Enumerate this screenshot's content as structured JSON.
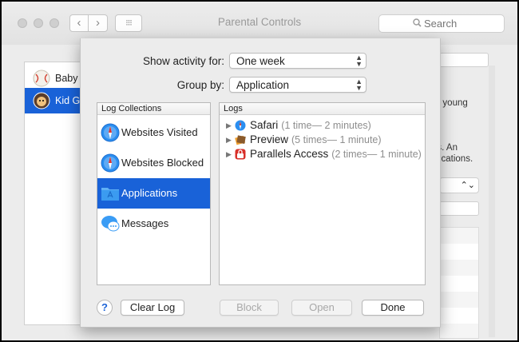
{
  "window": {
    "title": "Parental Controls",
    "nav_back": "‹",
    "nav_forward": "›",
    "grid_glyph": "⁝⁝⁝",
    "search_placeholder": "Search",
    "search_icon": "search-icon"
  },
  "background": {
    "users": [
      {
        "name": "Baby G",
        "icon": "baseball-avatar-icon"
      },
      {
        "name": "Kid Ge",
        "icon": "kid-avatar-icon",
        "selected": true
      }
    ],
    "right_text_1": "or young",
    "right_text_2a": "ns. An",
    "right_text_2b": "plications.",
    "select_arrows": "⌃⌄"
  },
  "sheet": {
    "show_activity_label": "Show activity for:",
    "show_activity_value": "One week",
    "group_by_label": "Group by:",
    "group_by_value": "Application",
    "collections_header": "Log Collections",
    "logs_header": "Logs",
    "collections": [
      {
        "label": "Websites Visited",
        "icon": "safari-compass-icon",
        "selected": false
      },
      {
        "label": "Websites Blocked",
        "icon": "safari-compass-icon",
        "selected": false
      },
      {
        "label": "Applications",
        "icon": "applications-folder-icon",
        "selected": true
      },
      {
        "label": "Messages",
        "icon": "messages-bubble-icon",
        "selected": false
      }
    ],
    "logs": [
      {
        "name": "Safari",
        "detail": "(1 time— 2 minutes)",
        "icon": "safari-icon"
      },
      {
        "name": "Preview",
        "detail": "(5 times— 1 minute)",
        "icon": "preview-icon"
      },
      {
        "name": "Parallels Access",
        "detail": "(2 times— 1 minute)",
        "icon": "parallels-access-icon"
      }
    ],
    "help_label": "?",
    "clear_log_label": "Clear Log",
    "block_label": "Block",
    "open_label": "Open",
    "done_label": "Done"
  },
  "colors": {
    "selection": "#1962d8",
    "window_bg": "#ececec",
    "detail_text": "#8e8e8e"
  }
}
